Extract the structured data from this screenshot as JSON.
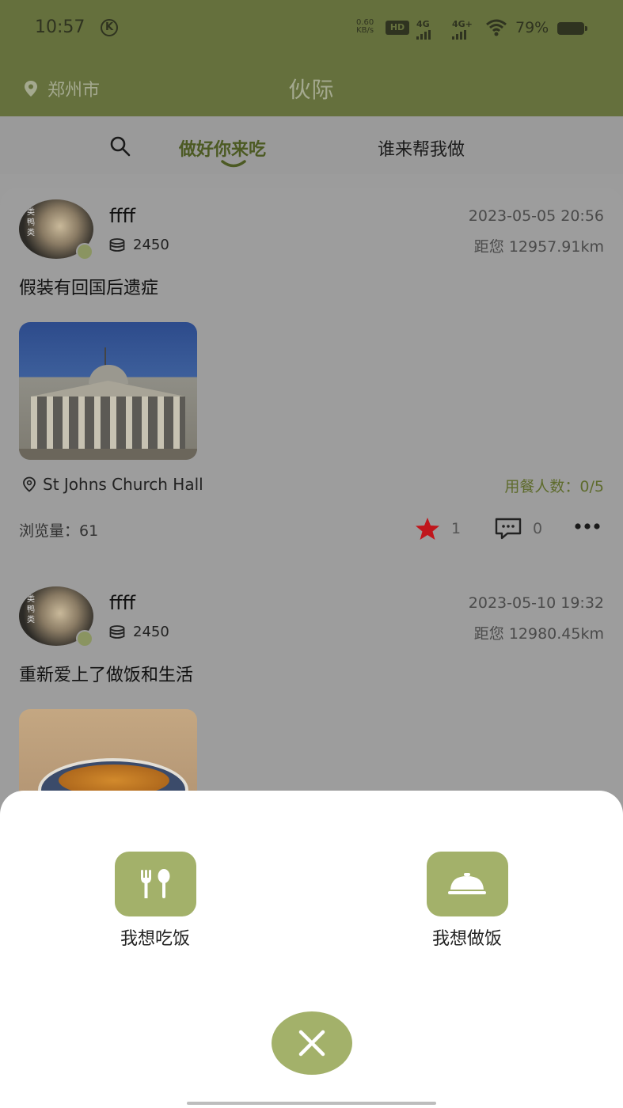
{
  "status_bar": {
    "time": "10:57",
    "k_badge": "K",
    "net_speed_value": "0.60",
    "net_speed_unit": "KB/s",
    "hd_label": "HD",
    "signal_1_label": "4G",
    "signal_2_label": "4G+",
    "battery_percent": "79%"
  },
  "header": {
    "location": "郑州市",
    "title": "伙际"
  },
  "tabs": {
    "active": "做好你来吃",
    "inactive": "谁来帮我做"
  },
  "posts": [
    {
      "username": "ffff",
      "avatar_tag": "类鸭类",
      "coins": "2450",
      "date": "2023-05-05 20:56",
      "distance": "距您 12957.91km",
      "content": "假装有回国后遗症",
      "place": "St Johns Church Hall",
      "diners": "用餐人数：0/5",
      "views": "浏览量：61",
      "likes": "1",
      "comments": "0"
    },
    {
      "username": "ffff",
      "avatar_tag": "类鸭类",
      "coins": "2450",
      "date": "2023-05-10 19:32",
      "distance": "距您 12980.45km",
      "content": "重新爱上了做饭和生活"
    }
  ],
  "sheet": {
    "option_eat": "我想吃饭",
    "option_cook": "我想做饭"
  },
  "colors": {
    "header_bg": "#65703d",
    "accent": "#a3b16a",
    "active_tab": "#4c5a23",
    "star": "#c0161c"
  }
}
